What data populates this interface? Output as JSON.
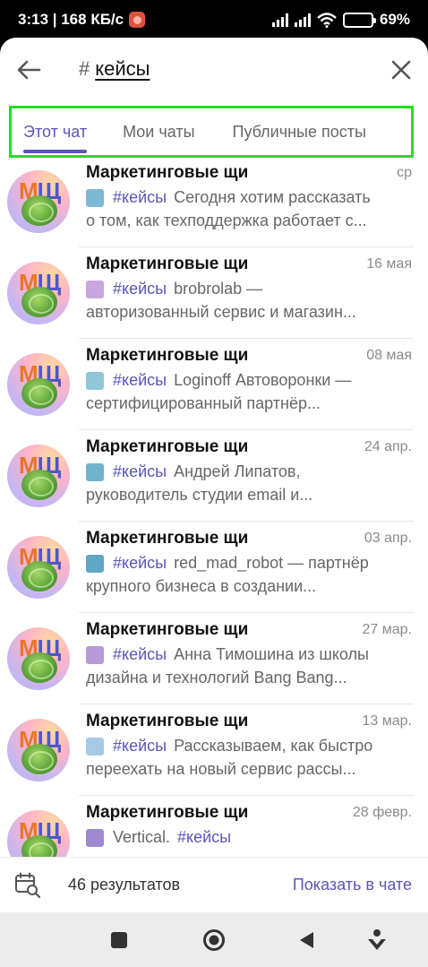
{
  "status_bar": {
    "time_speed": "3:13 | 168 КБ/с",
    "battery": "69%",
    "battery_level": 0.69
  },
  "search": {
    "back_icon": "arrow-left-icon",
    "hash": "#",
    "query": "кейсы",
    "close_icon": "close-icon"
  },
  "tabs": [
    {
      "label": "Этот чат",
      "active": true
    },
    {
      "label": "Мои чаты",
      "active": false
    },
    {
      "label": "Публичные посты",
      "active": false
    }
  ],
  "colors": {
    "accent": "#5a56b8",
    "highlight_box": "#22e01c"
  },
  "results": [
    {
      "title": "Маркетинговые щи",
      "date": "ср",
      "hashtag": "#кейсы",
      "line1_text": "Сегодня хотим рассказать",
      "line2": "о том, как техподдержка работает с...",
      "thumb": "#7db8d6"
    },
    {
      "title": "Маркетинговые щи",
      "date": "16 мая",
      "hashtag": "#кейсы",
      "line1_text": "brobrolab —",
      "line2": "авторизованный сервис и магазин...",
      "thumb": "#c9a6e0"
    },
    {
      "title": "Маркетинговые щи",
      "date": "08 мая",
      "hashtag": "#кейсы",
      "line1_text": "Loginoff Автоворонки —",
      "line2": "сертифицированный партнёр...",
      "thumb": "#8fc7d8"
    },
    {
      "title": "Маркетинговые щи",
      "date": "24 апр.",
      "hashtag": "#кейсы",
      "line1_text": "Андрей Липатов,",
      "line2": "руководитель студии email и...",
      "thumb": "#6fb2c9"
    },
    {
      "title": "Маркетинговые щи",
      "date": "03 апр.",
      "hashtag": "#кейсы",
      "line1_text": "red_mad_robot — партнёр",
      "line2": "крупного бизнеса в создании...",
      "thumb": "#5fa7c4"
    },
    {
      "title": "Маркетинговые щи",
      "date": "27 мар.",
      "hashtag": "#кейсы",
      "line1_text": "Анна Тимошина из школы",
      "line2": "дизайна и технологий Bang Bang...",
      "thumb": "#b79ad8"
    },
    {
      "title": "Маркетинговые щи",
      "date": "13 мар.",
      "hashtag": "#кейсы",
      "line1_text": "Рассказываем, как быстро",
      "line2": "переехать на новый сервис рассы...",
      "thumb": "#a6c9e6"
    },
    {
      "title": "Маркетинговые щи",
      "date": "28 февр.",
      "hashtag": "#кейсы",
      "line1_text": "Vertical.",
      "line2": "",
      "thumb": "#9f8ad0",
      "tag_after": true
    }
  ],
  "bottom": {
    "count": "46 результатов",
    "action": "Показать в чате"
  },
  "nav": {
    "recents_icon": "square-icon",
    "home_icon": "circle-home-icon",
    "back_icon": "triangle-back-icon",
    "assist_icon": "assistant-icon"
  }
}
